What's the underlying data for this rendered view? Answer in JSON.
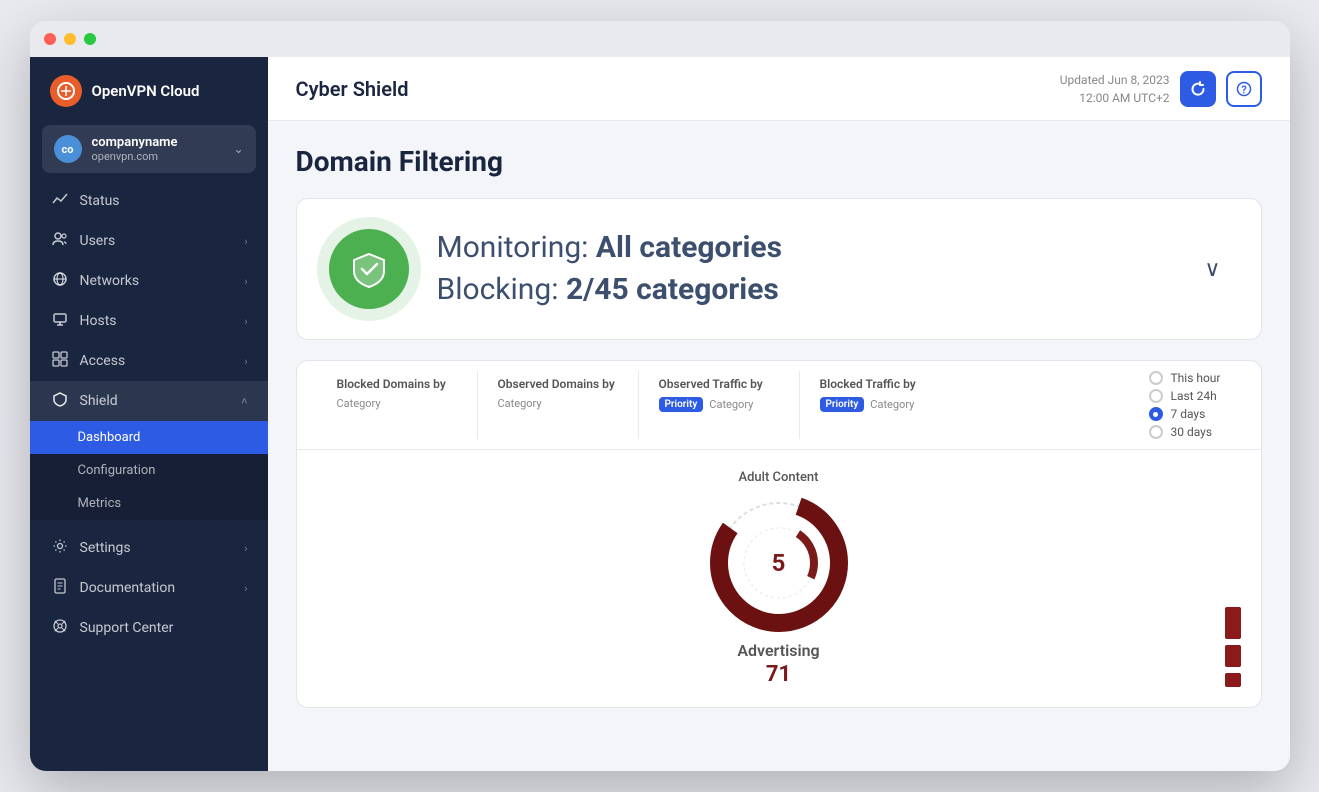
{
  "window": {
    "titlebar": {
      "dots": [
        "red",
        "yellow",
        "green"
      ]
    }
  },
  "sidebar": {
    "logo": {
      "icon": "⊙",
      "text": "OpenVPN Cloud"
    },
    "account": {
      "name": "companyname",
      "sub": "openvpn.com",
      "chevron": "⌃"
    },
    "nav_items": [
      {
        "id": "status",
        "icon": "📈",
        "label": "Status",
        "has_chevron": false
      },
      {
        "id": "users",
        "icon": "👤",
        "label": "Users",
        "has_chevron": true
      },
      {
        "id": "networks",
        "icon": "🌐",
        "label": "Networks",
        "has_chevron": true
      },
      {
        "id": "hosts",
        "icon": "🖥",
        "label": "Hosts",
        "has_chevron": true
      },
      {
        "id": "access",
        "icon": "⊞",
        "label": "Access",
        "has_chevron": true
      },
      {
        "id": "shield",
        "icon": "🛡",
        "label": "Shield",
        "has_chevron": true,
        "active": true
      }
    ],
    "shield_sub": [
      {
        "id": "dashboard",
        "label": "Dashboard",
        "active": true
      },
      {
        "id": "configuration",
        "label": "Configuration",
        "active": false
      },
      {
        "id": "metrics",
        "label": "Metrics",
        "active": false
      }
    ],
    "bottom_nav": [
      {
        "id": "settings",
        "icon": "⚙",
        "label": "Settings",
        "has_chevron": true
      },
      {
        "id": "documentation",
        "icon": "📄",
        "label": "Documentation",
        "has_chevron": true
      },
      {
        "id": "support",
        "icon": "💬",
        "label": "Support Center",
        "has_chevron": false
      }
    ]
  },
  "topbar": {
    "page_title": "Cyber Shield",
    "updated_line1": "Updated Jun 8, 2023",
    "updated_line2": "12:00 AM UTC+2",
    "refresh_icon": "↻",
    "help_icon": "?"
  },
  "content": {
    "section_title": "Domain Filtering",
    "monitoring_card": {
      "monitoring_label": "Monitoring:",
      "monitoring_value": "All categories",
      "blocking_label": "Blocking:",
      "blocking_value": "2/45 categories",
      "chevron": "∨"
    },
    "stats": {
      "tabs": [
        {
          "title": "Blocked Domains by",
          "subtitle": "Category"
        },
        {
          "title": "Observed Domains by",
          "subtitle": "Category"
        },
        {
          "title": "Observed Traffic by",
          "subtitle_badge": "Priority",
          "subtitle": "Category"
        },
        {
          "title": "Blocked Traffic by",
          "subtitle_badge": "Priority",
          "subtitle": "Category"
        }
      ],
      "time_options": [
        {
          "id": "this_hour",
          "label": "This hour",
          "selected": false
        },
        {
          "id": "last_24h",
          "label": "Last 24h",
          "selected": false
        },
        {
          "id": "7_days",
          "label": "7 days",
          "selected": true
        },
        {
          "id": "30_days",
          "label": "30 days",
          "selected": false
        }
      ]
    },
    "chart": {
      "inner_label": "Adult Content",
      "inner_count": "5",
      "outer_label": "Advertising",
      "outer_count": "71"
    }
  }
}
